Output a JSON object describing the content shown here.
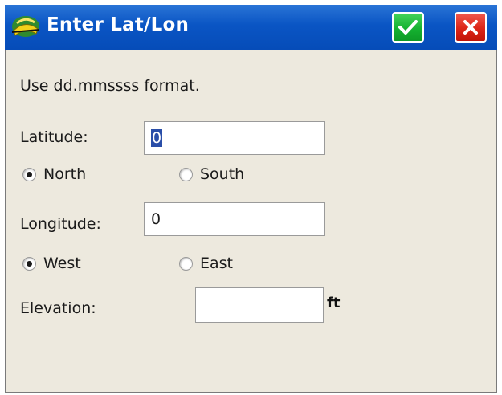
{
  "window": {
    "title": "Enter Lat/Lon",
    "icon": "surveyor-hardhat-icon",
    "ok_icon": "checkmark-icon",
    "close_icon": "close-x-icon"
  },
  "form": {
    "instruction": "Use dd.mmssss format.",
    "latitude": {
      "label": "Latitude:",
      "value": "0",
      "options": [
        "North",
        "South"
      ],
      "selected": "North"
    },
    "longitude": {
      "label": "Longitude:",
      "value": "0",
      "options": [
        "West",
        "East"
      ],
      "selected": "West"
    },
    "elevation": {
      "label": "Elevation:",
      "value": "",
      "unit": "ft"
    }
  },
  "colors": {
    "titlebar": "#0a55c4",
    "dialog_bg": "#ede9de",
    "ok_button": "#15b230",
    "close_button": "#dc2517",
    "selection": "#2a4ea8"
  }
}
